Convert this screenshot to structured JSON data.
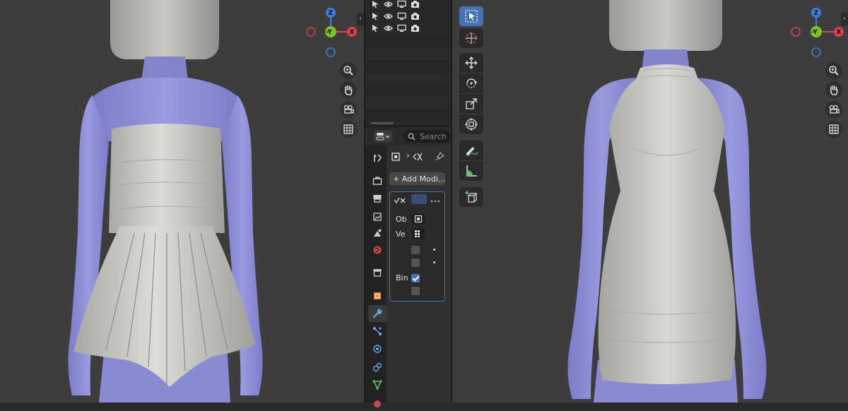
{
  "viewport_left": {
    "gizmo": {
      "z": "Z",
      "y": "-Y",
      "x": "X"
    },
    "nav_icons": [
      "zoom-icon",
      "hand-icon",
      "camera-icon",
      "grid-icon"
    ]
  },
  "viewport_right": {
    "gizmo": {
      "z": "Z",
      "y": "-Y",
      "x": "X"
    },
    "nav_icons": [
      "zoom-icon",
      "hand-icon",
      "camera-icon",
      "grid-icon"
    ]
  },
  "outliner": {
    "row_icons": [
      "select-arrow-icon",
      "eye-icon",
      "monitor-icon",
      "camera-icon"
    ],
    "row_count": 3
  },
  "properties": {
    "search_placeholder": "Search",
    "add_modifier_label": "+ Add Modi...",
    "modifier": {
      "object_label": "Ob",
      "vertex_label": "Ve",
      "bind_label": "Bin",
      "bind_checked": true
    },
    "tabs": [
      "tool",
      "render",
      "output",
      "view-layer",
      "scene",
      "world",
      "collection",
      "object",
      "modifiers",
      "particles",
      "physics",
      "constraints",
      "data",
      "material"
    ],
    "active_tab": "modifiers"
  },
  "toolbar": {
    "tools": [
      "select-box",
      "cursor",
      "move",
      "rotate",
      "scale",
      "transform",
      "annotate",
      "measure",
      "add-cube"
    ],
    "active_tool": "select-box"
  },
  "colors": {
    "accent": "#4772b3",
    "viewport_bg": "#3d3d3d",
    "axis_x": "#e0404f",
    "axis_y": "#7ec32c",
    "axis_z": "#3b7de0",
    "body": "#8f8fd6",
    "cloth": "#c6c6c2"
  }
}
